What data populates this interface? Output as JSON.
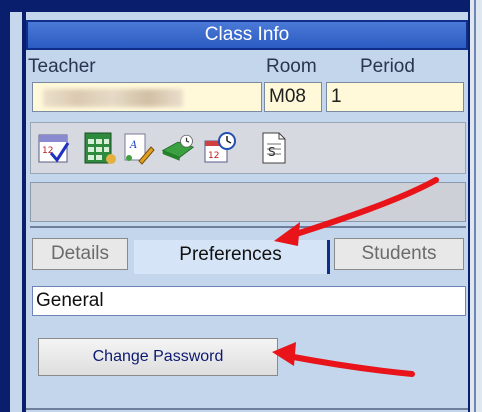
{
  "panel": {
    "title": "Class Info"
  },
  "columns": {
    "teacher": "Teacher",
    "room": "Room",
    "period": "Period"
  },
  "row": {
    "teacher_value": "",
    "room_value": "M08",
    "period_value": "1"
  },
  "tools": [
    {
      "icon": "calendar-check-icon"
    },
    {
      "icon": "class-grid-icon"
    },
    {
      "icon": "document-edit-icon"
    },
    {
      "icon": "book-timer-icon"
    },
    {
      "icon": "calendar-clock-icon"
    },
    {
      "icon": "report-document-icon"
    }
  ],
  "tabs": {
    "details": "Details",
    "preferences": "Preferences",
    "students": "Students"
  },
  "preferences": {
    "section_label": "General",
    "change_password_label": "Change Password"
  },
  "colors": {
    "title_bar": "#2c5cc2",
    "arrow": "#e8141a",
    "active_tab": "#d5e4f6",
    "row_background": "#fff9da"
  }
}
